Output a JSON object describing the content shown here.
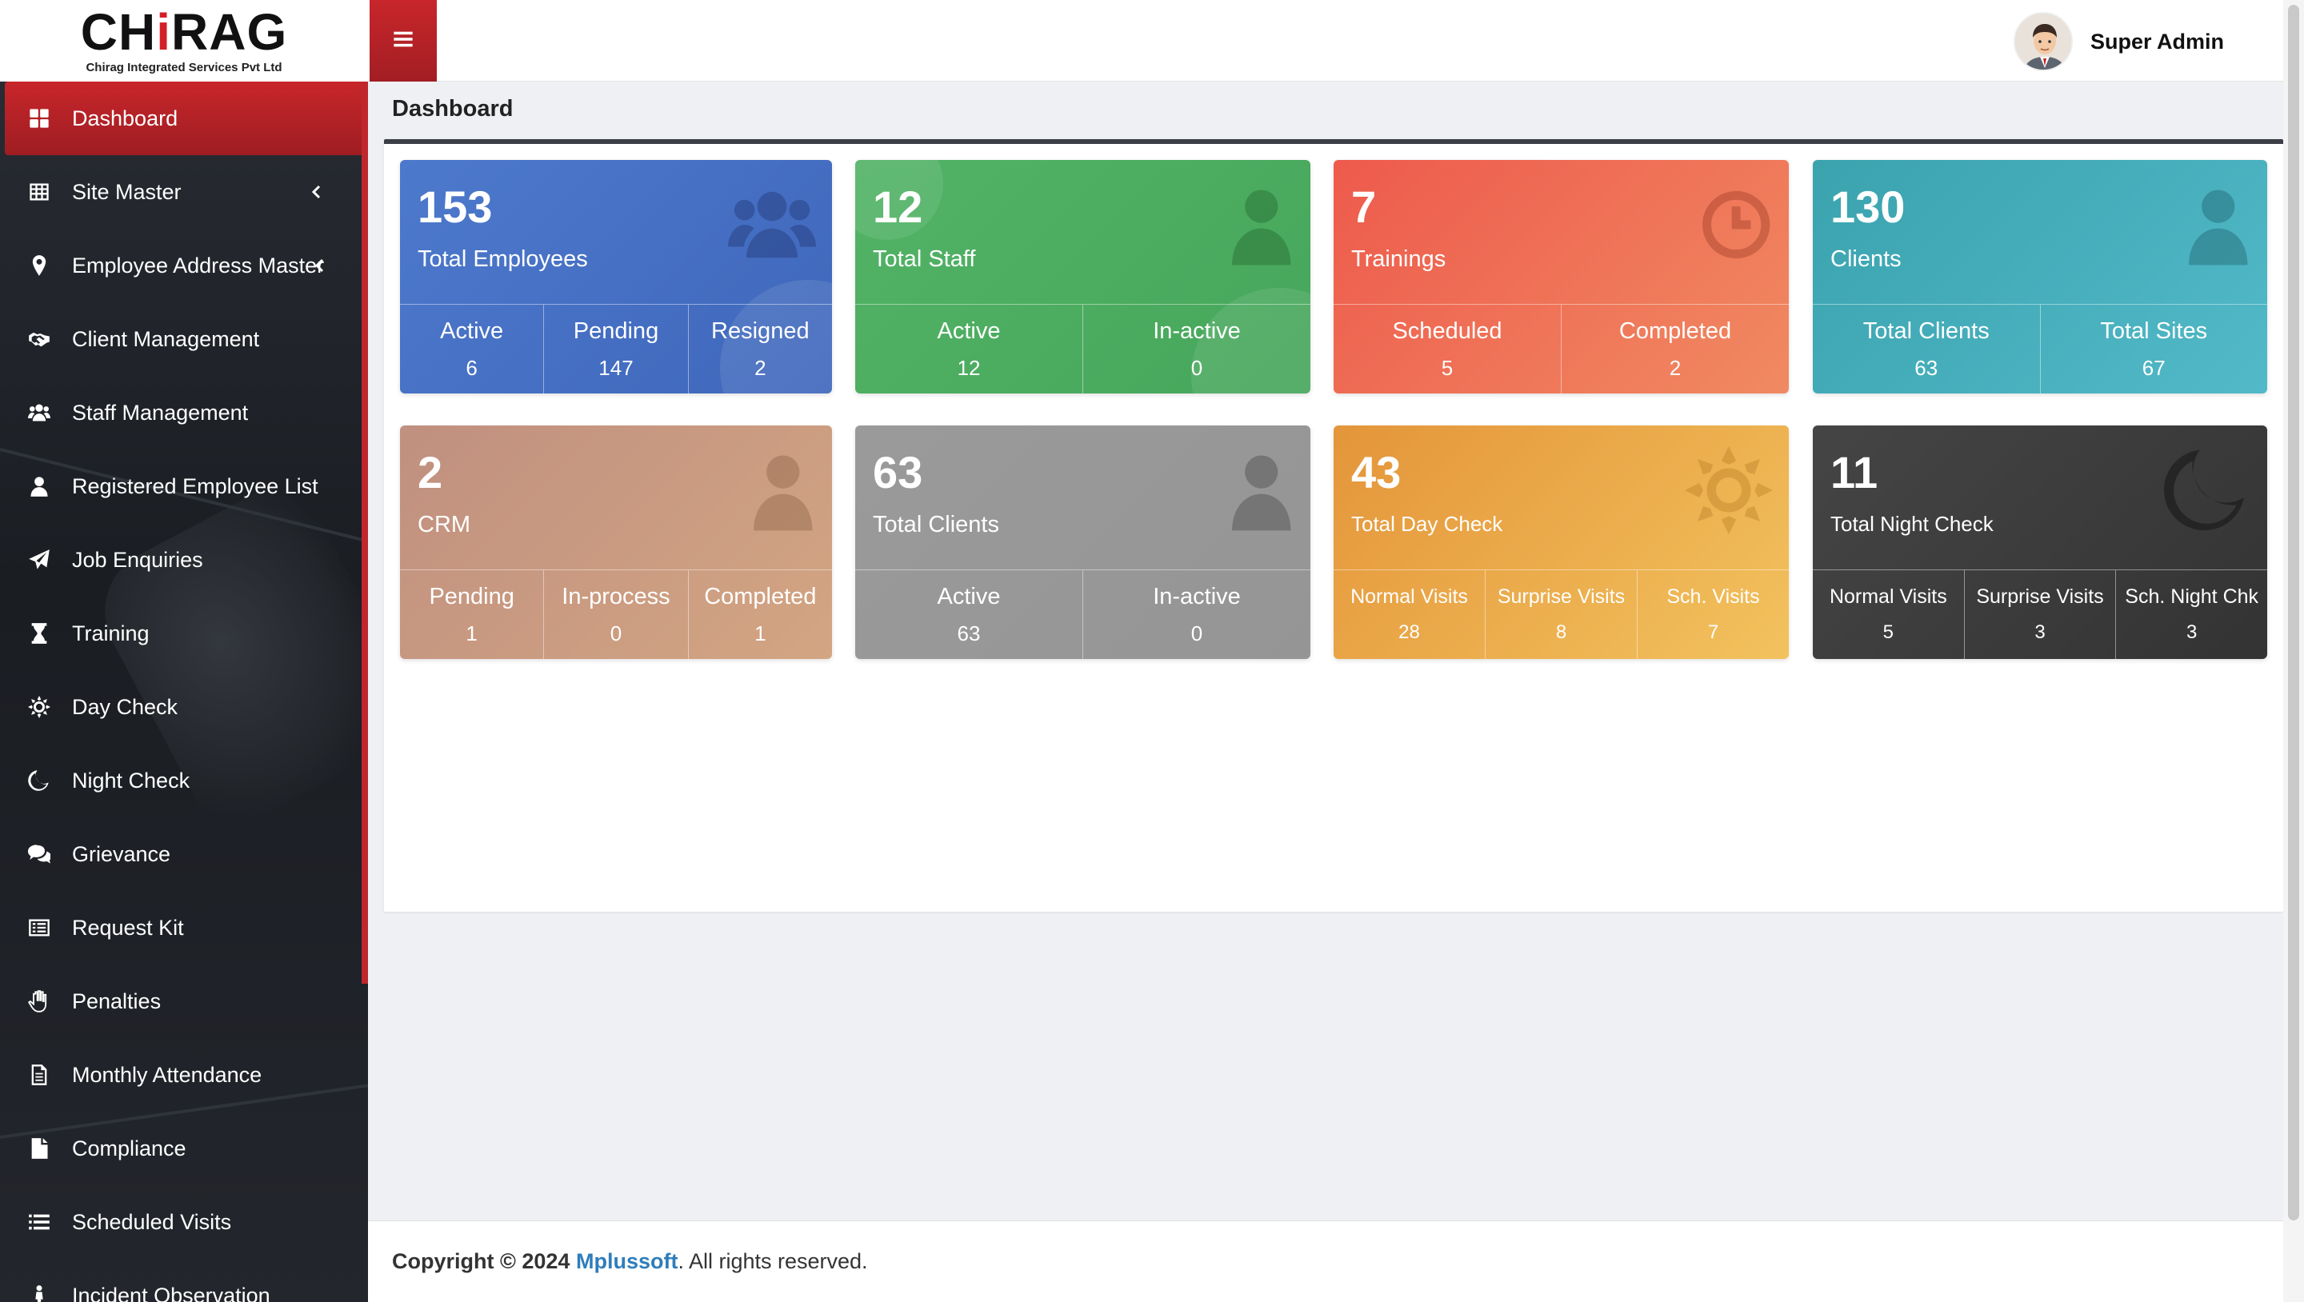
{
  "brand": {
    "name_pre": "CH",
    "name_i": "i",
    "name_post": "RAG",
    "subtitle": "Chirag Integrated Services Pvt Ltd"
  },
  "header": {
    "user_name": "Super Admin"
  },
  "page": {
    "title": "Dashboard"
  },
  "sidebar": {
    "items": [
      {
        "label": "Dashboard",
        "icon": "dashboard-icon"
      },
      {
        "label": "Site Master",
        "icon": "table-icon"
      },
      {
        "label": "Employee Address Master",
        "icon": "map-pin-icon"
      },
      {
        "label": "Client Management",
        "icon": "handshake-icon"
      },
      {
        "label": "Staff Management",
        "icon": "users-icon"
      },
      {
        "label": "Registered Employee List",
        "icon": "user-icon"
      },
      {
        "label": "Job Enquiries",
        "icon": "paper-plane-icon"
      },
      {
        "label": "Training",
        "icon": "hourglass-icon"
      },
      {
        "label": "Day Check",
        "icon": "sun-icon"
      },
      {
        "label": "Night Check",
        "icon": "moon-icon"
      },
      {
        "label": "Grievance",
        "icon": "comments-icon"
      },
      {
        "label": "Request Kit",
        "icon": "list-alt-icon"
      },
      {
        "label": "Penalties",
        "icon": "hand-icon"
      },
      {
        "label": "Monthly Attendance",
        "icon": "file-text-icon"
      },
      {
        "label": "Compliance",
        "icon": "file-icon"
      },
      {
        "label": "Scheduled Visits",
        "icon": "list-icon"
      },
      {
        "label": "Incident Observation",
        "icon": "person-icon"
      }
    ]
  },
  "cards": {
    "employees": {
      "count": "153",
      "label": "Total Employees",
      "icon": "users-icon",
      "stats": [
        {
          "t": "Active",
          "v": "6"
        },
        {
          "t": "Pending",
          "v": "147"
        },
        {
          "t": "Resigned",
          "v": "2"
        }
      ]
    },
    "staff": {
      "count": "12",
      "label": "Total Staff",
      "icon": "user-icon",
      "stats": [
        {
          "t": "Active",
          "v": "12"
        },
        {
          "t": "In-active",
          "v": "0"
        }
      ]
    },
    "trainings": {
      "count": "7",
      "label": "Trainings",
      "icon": "clock-icon",
      "stats": [
        {
          "t": "Scheduled",
          "v": "5"
        },
        {
          "t": "Completed",
          "v": "2"
        }
      ]
    },
    "clients": {
      "count": "130",
      "label": "Clients",
      "icon": "user-icon",
      "stats": [
        {
          "t": "Total Clients",
          "v": "63"
        },
        {
          "t": "Total Sites",
          "v": "67"
        }
      ]
    },
    "crm": {
      "count": "2",
      "label": "CRM",
      "icon": "user-icon",
      "stats": [
        {
          "t": "Pending",
          "v": "1"
        },
        {
          "t": "In-process",
          "v": "0"
        },
        {
          "t": "Completed",
          "v": "1"
        }
      ]
    },
    "total_clients": {
      "count": "63",
      "label": "Total Clients",
      "icon": "user-icon",
      "stats": [
        {
          "t": "Active",
          "v": "63"
        },
        {
          "t": "In-active",
          "v": "0"
        }
      ]
    },
    "day_check": {
      "count": "43",
      "label": "Total Day Check",
      "icon": "sun-icon",
      "stats": [
        {
          "t": "Normal Visits",
          "v": "28"
        },
        {
          "t": "Surprise Visits",
          "v": "8"
        },
        {
          "t": "Sch. Visits",
          "v": "7"
        }
      ]
    },
    "night_check": {
      "count": "11",
      "label": "Total Night Check",
      "icon": "moon-icon",
      "stats": [
        {
          "t": "Normal Visits",
          "v": "5"
        },
        {
          "t": "Surprise Visits",
          "v": "3"
        },
        {
          "t": "Sch. Night Chk",
          "v": "3"
        }
      ]
    }
  },
  "colors": {
    "accent_red": "#c8262b",
    "employees": "#4470c4",
    "staff": "#4fae62",
    "trainings": "#ef6b55",
    "clients": "#3fa9b4",
    "crm": "#c99a80",
    "total_clients": "#999999",
    "day_check": "#eaa840",
    "night_check": "#3a3a3a"
  },
  "footer": {
    "prefix": "Copyright © 2024",
    "company": "Mplussoft",
    "suffix": ". All rights reserved."
  }
}
